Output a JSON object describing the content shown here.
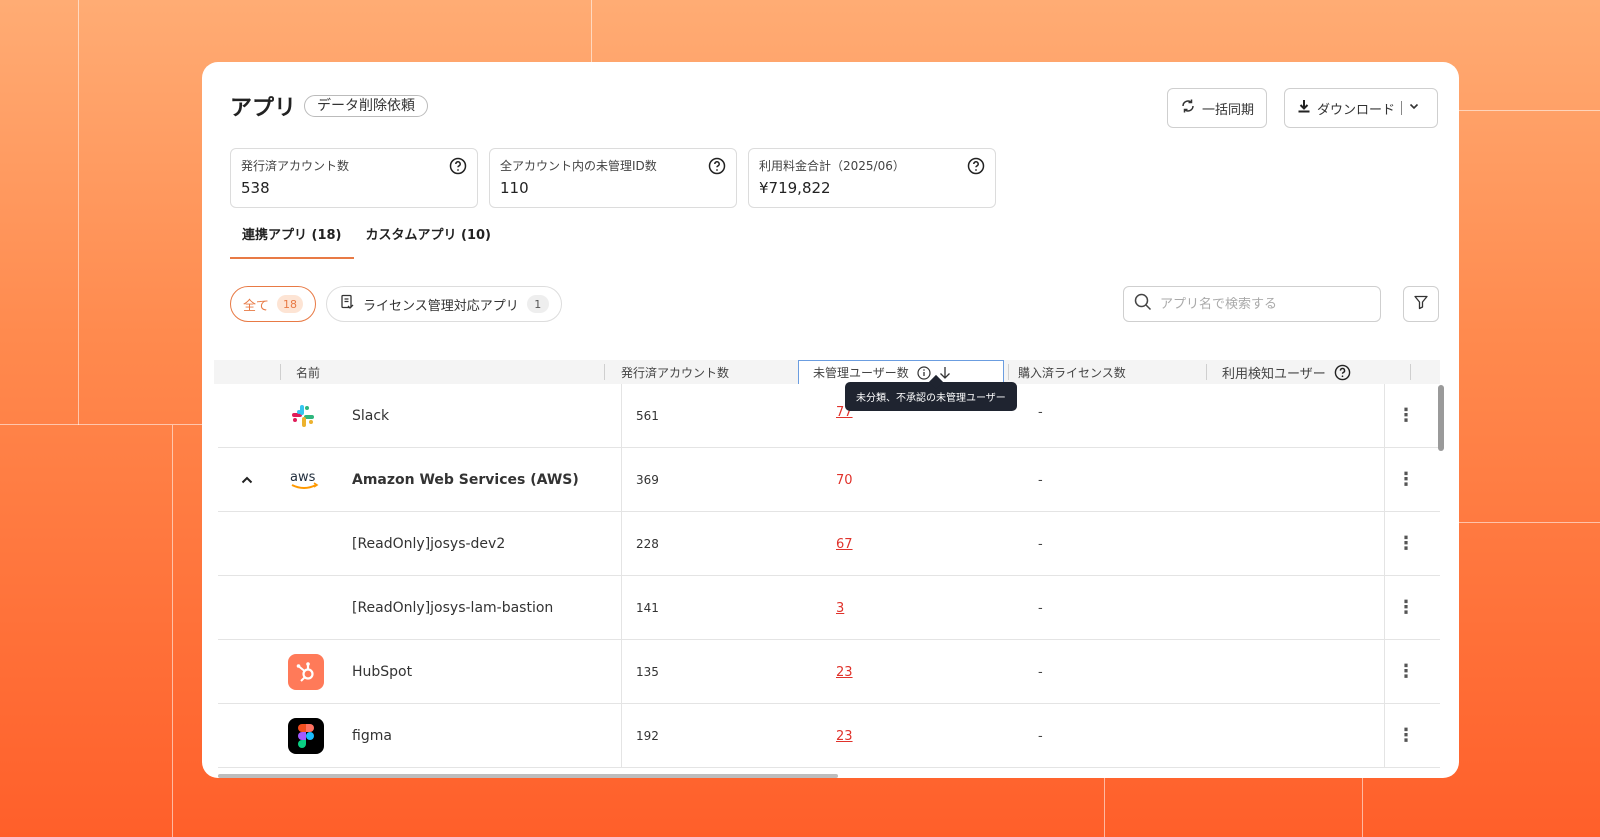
{
  "header": {
    "title": "アプリ",
    "delete_request_label": "データ削除依頼",
    "sync_label": "一括同期",
    "download_label": "ダウンロード"
  },
  "stats": [
    {
      "label": "発行済アカウント数",
      "value": "538"
    },
    {
      "label": "全アカウント内の未管理ID数",
      "value": "110"
    },
    {
      "label": "利用料金合計（2025/06）",
      "value": "¥719,822"
    }
  ],
  "tabs": [
    {
      "label": "連携アプリ (18)",
      "active": true
    },
    {
      "label": "カスタムアプリ (10)",
      "active": false
    }
  ],
  "filters": [
    {
      "label": "全て",
      "count": "18",
      "active": true
    },
    {
      "label": "ライセンス管理対応アプリ",
      "count": "1",
      "active": false
    }
  ],
  "search": {
    "placeholder": "アプリ名で検索する"
  },
  "table": {
    "headers": {
      "name": "名前",
      "issued": "発行済アカウント数",
      "unmanaged": "未管理ユーザー数",
      "purchased": "購入済ライセンス数",
      "detected": "利用検知ユーザー"
    },
    "tooltip": "未分類、不承認の未管理ユーザー",
    "rows": [
      {
        "name": "Slack",
        "issued": "561",
        "unmanaged": "77",
        "purchased": "-",
        "icon": "slack-icon"
      },
      {
        "name": "Amazon Web Services (AWS)",
        "issued": "369",
        "unmanaged": "70",
        "purchased": "-",
        "icon": "aws-icon",
        "expanded": true
      },
      {
        "name": "[ReadOnly]josys-dev2",
        "issued": "228",
        "unmanaged": "67",
        "purchased": "-"
      },
      {
        "name": "[ReadOnly]josys-lam-bastion",
        "issued": "141",
        "unmanaged": "3",
        "purchased": "-"
      },
      {
        "name": "HubSpot",
        "issued": "135",
        "unmanaged": "23",
        "purchased": "-",
        "icon": "hubspot-icon"
      },
      {
        "name": "figma",
        "issued": "192",
        "unmanaged": "23",
        "purchased": "-",
        "icon": "figma-icon"
      }
    ]
  },
  "colors": {
    "accent": "#e87a45",
    "unmanaged": "#e0322b",
    "tooltip_bg": "#1f2430"
  }
}
